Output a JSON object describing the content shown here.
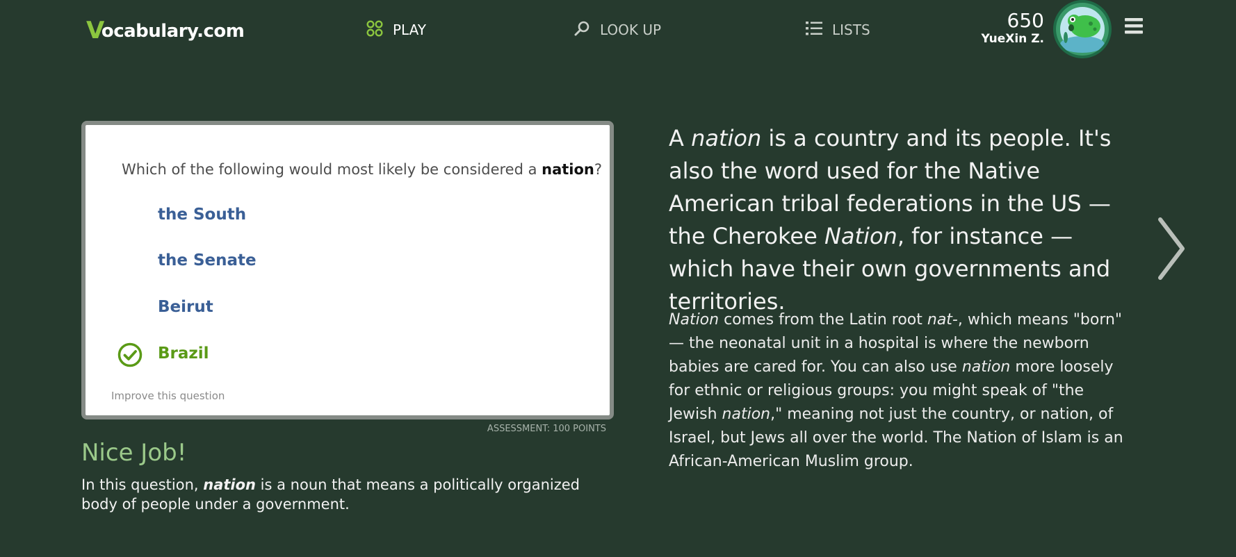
{
  "header": {
    "logo": {
      "mark": "V",
      "text": "ocabulary.com"
    },
    "nav": {
      "play": "PLAY",
      "look_up": "LOOK UP",
      "lists": "LISTS"
    },
    "points": "650",
    "user_name": "YueXin Z."
  },
  "quiz": {
    "question": {
      "before": "Which of the following would most likely be considered a ",
      "word": "nation",
      "after": "?"
    },
    "choices": [
      "the South",
      "the Senate",
      "Beirut",
      "Brazil"
    ],
    "correct_index": 3,
    "improve_link": "Improve this question",
    "assessment": "ASSESSMENT: 100 POINTS"
  },
  "feedback": {
    "title": "Nice Job!",
    "text_before": "In this question, ",
    "word": "nation",
    "text_after": " is a noun that means a politically organized body of people under a government."
  },
  "definition": {
    "short": {
      "p1": "A ",
      "w1": "nation",
      "p2": " is a country and its people. It's also the word used for the Native American tribal federations in the US — the Cherokee ",
      "w2": "Nation",
      "p3": ", for instance — which have their own governments and territories."
    },
    "long": {
      "w1": "Nation",
      "p1": " comes from the Latin root ",
      "w2": "nat-",
      "p2": ", which means \"born\" — the neonatal unit in a hospital is where the newborn babies are cared for. You can also use ",
      "w3": "nation",
      "p3": " more loosely for ethnic or religious groups: you might speak of \"the Jewish ",
      "w4": "nation",
      "p4": ",\" meaning not just the country, or nation, of Israel, but Jews all over the world. The Nation of Islam is an African-American Muslim group."
    }
  },
  "icons": {
    "play": "play-grid-icon",
    "look_up": "magnifier-icon",
    "lists": "list-icon",
    "menu": "hamburger-icon",
    "correct": "check-circle-icon",
    "next": "chevron-right-icon"
  },
  "colors": {
    "background": "#263a2e",
    "accent_green": "#8cc63f",
    "choice_blue": "#3a5f96",
    "correct_green": "#5a9a16",
    "nice_job": "#9bc98a"
  }
}
